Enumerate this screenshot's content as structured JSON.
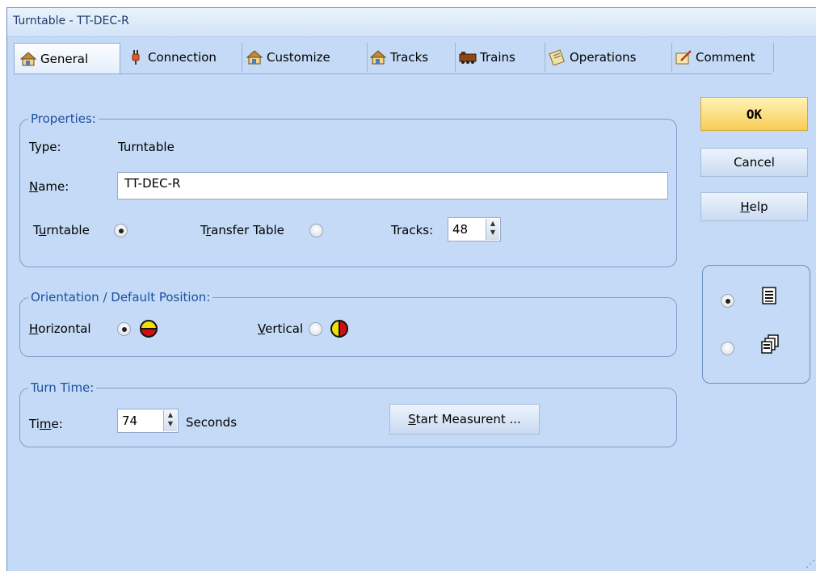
{
  "window": {
    "title": "Turntable - TT-DEC-R"
  },
  "tabs": [
    {
      "label": "General",
      "icon": "house-icon"
    },
    {
      "label": "Connection",
      "icon": "plug-icon"
    },
    {
      "label": "Customize",
      "icon": "house-icon"
    },
    {
      "label": "Tracks",
      "icon": "house-icon"
    },
    {
      "label": "Trains",
      "icon": "train-icon"
    },
    {
      "label": "Operations",
      "icon": "clipboard-icon"
    },
    {
      "label": "Comment",
      "icon": "notepad-icon"
    }
  ],
  "properties": {
    "title": "Properties:",
    "type_label": "Type:",
    "type_value": "Turntable",
    "name_label_rest": "ame:",
    "name_label_key": "N",
    "name_value": "TT-DEC-R",
    "turntable_label_pre": "T",
    "turntable_label_key": "u",
    "turntable_label_post": "rntable",
    "transfer_label_pre": "T",
    "transfer_label_key": "r",
    "transfer_label_post": "ansfer Table",
    "tracks_label": "Tracks:",
    "tracks_value": "48",
    "selected": "turntable"
  },
  "orientation": {
    "title": "Orientation / Default Position:",
    "horizontal_key": "H",
    "horizontal_rest": "orizontal",
    "vertical_key": "V",
    "vertical_rest": "ertical",
    "selected": "horizontal"
  },
  "turn_time": {
    "title": "Turn Time:",
    "time_pre": "Ti",
    "time_key": "m",
    "time_post": "e:",
    "time_value": "74",
    "seconds_label": "Seconds",
    "start_key": "S",
    "start_rest": "tart Measurent ..."
  },
  "buttons": {
    "ok": "OK",
    "cancel": "Cancel",
    "help_key": "H",
    "help_rest": "elp"
  },
  "view_options": {
    "selected": "list"
  },
  "colors": {
    "accent_blue": "#1c4f9e",
    "ok_yellow": "#f8cd55",
    "window_bg": "#c4daf6"
  }
}
